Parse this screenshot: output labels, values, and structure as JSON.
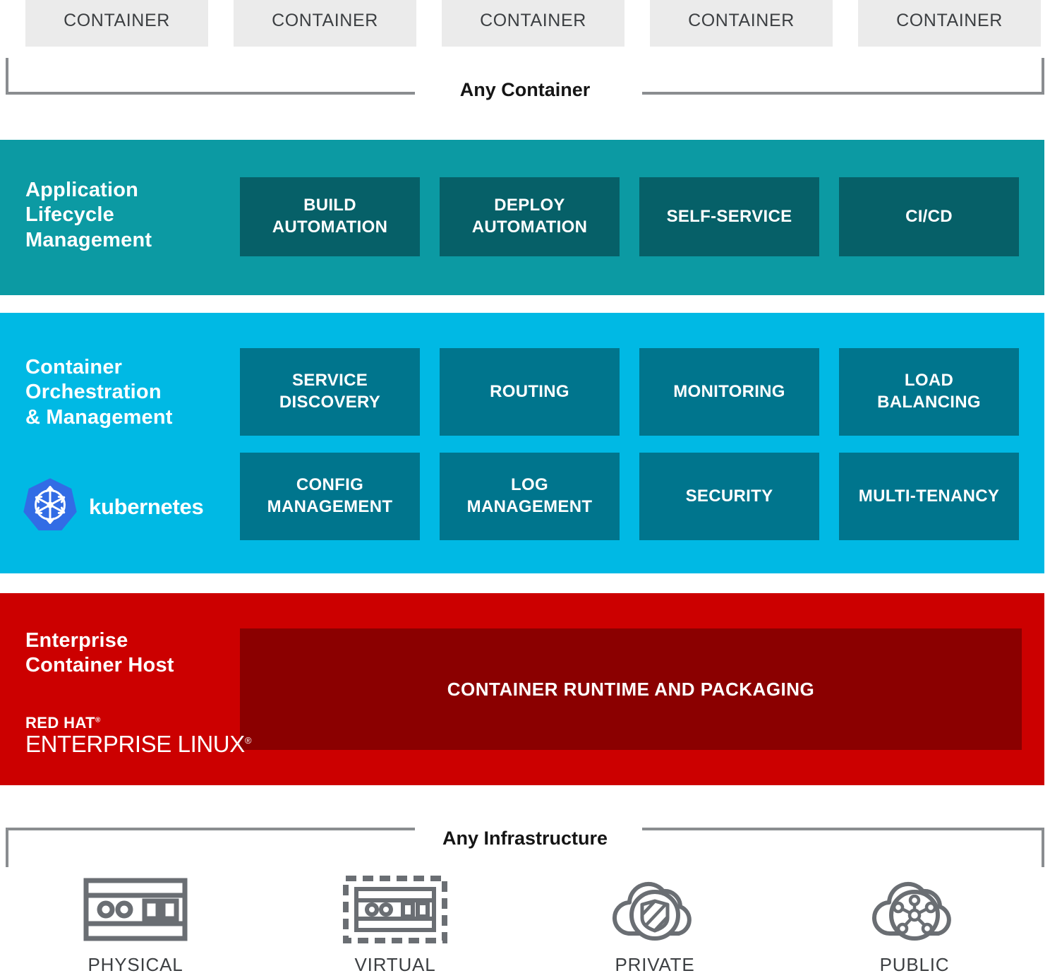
{
  "top": {
    "containers": [
      {
        "label": "CONTAINER"
      },
      {
        "label": "CONTAINER"
      },
      {
        "label": "CONTAINER"
      },
      {
        "label": "CONTAINER"
      },
      {
        "label": "CONTAINER"
      }
    ],
    "bracket_label": "Any Container"
  },
  "bands": {
    "alm": {
      "title_line1": "Application",
      "title_line2": "Lifecycle",
      "title_line3": "Management",
      "color": "#0C9AA3",
      "cell_color": "#066068",
      "cells": [
        {
          "line1": "BUILD",
          "line2": "AUTOMATION"
        },
        {
          "line1": "DEPLOY",
          "line2": "AUTOMATION"
        },
        {
          "line1": "SELF-SERVICE",
          "line2": ""
        },
        {
          "line1": "CI/CD",
          "line2": ""
        }
      ]
    },
    "orchestration": {
      "title_line1": "Container",
      "title_line2": "Orchestration",
      "title_line3": "& Management",
      "color": "#00B9E4",
      "cell_color": "#00758D",
      "logo_label": "kubernetes",
      "logo_color": "#326CE5",
      "row1": [
        {
          "line1": "SERVICE",
          "line2": "DISCOVERY"
        },
        {
          "line1": "ROUTING",
          "line2": ""
        },
        {
          "line1": "MONITORING",
          "line2": ""
        },
        {
          "line1": "LOAD",
          "line2": "BALANCING"
        }
      ],
      "row2": [
        {
          "line1": "CONFIG",
          "line2": "MANAGEMENT"
        },
        {
          "line1": "LOG",
          "line2": "MANAGEMENT"
        },
        {
          "line1": "SECURITY",
          "line2": ""
        },
        {
          "line1": "MULTI-TENANCY",
          "line2": ""
        }
      ]
    },
    "host": {
      "title_line1": "Enterprise",
      "title_line2": "Container Host",
      "color": "#CC0000",
      "cell_color": "#8B0000",
      "runtime_label": "CONTAINER RUNTIME AND PACKAGING",
      "logo_line1": "RED HAT",
      "logo_line2": "ENTERPRISE LINUX",
      "logo_mark": "®"
    }
  },
  "bottom": {
    "bracket_label": "Any Infrastructure",
    "items": [
      {
        "label": "PHYSICAL",
        "icon": "server-icon"
      },
      {
        "label": "VIRTUAL",
        "icon": "virtual-server-icon"
      },
      {
        "label": "PRIVATE",
        "icon": "private-cloud-icon"
      },
      {
        "label": "PUBLIC",
        "icon": "public-cloud-icon"
      }
    ],
    "icon_color": "#6A6E73"
  }
}
